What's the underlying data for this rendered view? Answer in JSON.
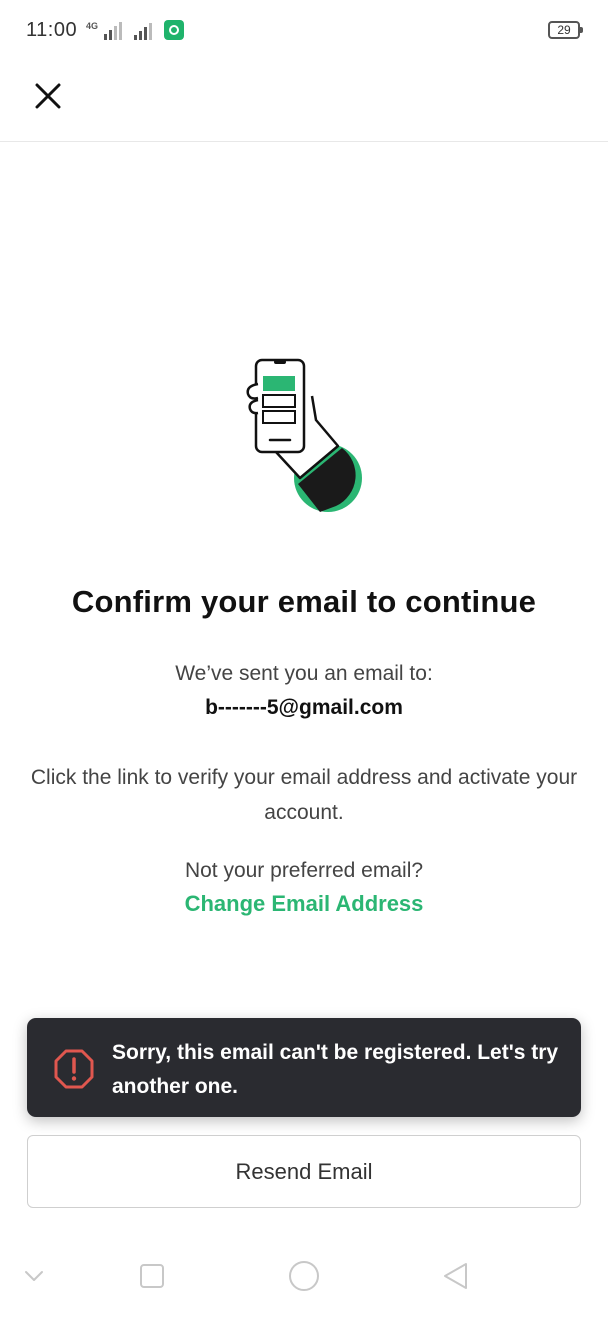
{
  "status_bar": {
    "time": "11:00",
    "network_label": "4G",
    "battery": "29"
  },
  "header": {
    "close_icon": "close-icon"
  },
  "main": {
    "title": "Confirm your email to continue",
    "sent_text": "We’ve sent you an email to:",
    "email": "b-------5@gmail.com",
    "instructions": "Click the link to verify your email address and activate your account.",
    "not_preferred": "Not your preferred email?",
    "change_link": "Change Email Address"
  },
  "toast": {
    "icon": "alert-octagon-icon",
    "message": "Sorry, this email can't be registered. Let's try another one."
  },
  "resend_button": "Resend Email",
  "nav": {
    "items": [
      "chevron-down-icon",
      "square-icon",
      "circle-icon",
      "triangle-back-icon"
    ]
  },
  "colors": {
    "accent": "#2bb673",
    "toast_bg": "#2a2b30",
    "error": "#e0574f"
  }
}
